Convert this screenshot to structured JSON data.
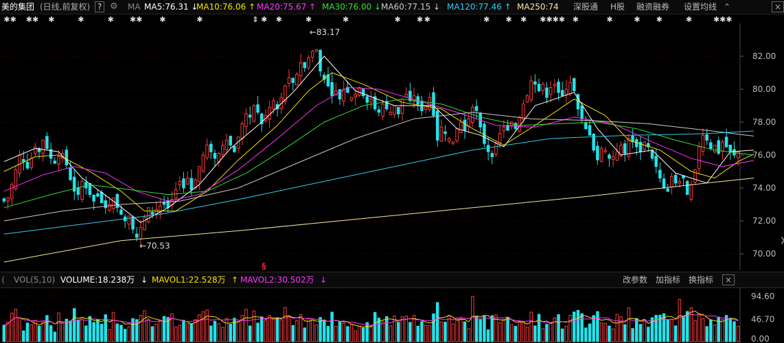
{
  "header": {
    "stock_name": "美的集团",
    "period_label": "(日线,前复权)",
    "help_label": "?",
    "ma_label": "MA",
    "ma_values": [
      {
        "label": "MA5:76.31",
        "arrow": "↓",
        "color": "#ffffff"
      },
      {
        "label": "MA10:76.06",
        "arrow": "↑",
        "color": "#f5e000"
      },
      {
        "label": "MA20:75.67",
        "arrow": "↑",
        "color": "#ff33ff"
      },
      {
        "label": "MA30:76.00",
        "arrow": "↓",
        "color": "#33dd33"
      },
      {
        "label": "MA60:77.15",
        "arrow": "↓",
        "color": "#cccccc"
      },
      {
        "label": "MA120:77.46",
        "arrow": "↑",
        "color": "#33ccee"
      },
      {
        "label": "MA250:74",
        "arrow": "",
        "color": "#f5e9a0"
      }
    ],
    "menu": [
      "深股通",
      "H股",
      "融资融券",
      "设置均线"
    ],
    "close_label": "×"
  },
  "markers": [
    {
      "label": "✱✱",
      "pos": 0.005
    },
    {
      "label": "✱✱",
      "pos": 0.035
    },
    {
      "label": "✱",
      "pos": 0.065
    },
    {
      "label": "✱",
      "pos": 0.105
    },
    {
      "label": "✱",
      "pos": 0.145
    },
    {
      "label": "✱✱",
      "pos": 0.175
    },
    {
      "label": "✱",
      "pos": 0.215
    },
    {
      "label": "✱",
      "pos": 0.265
    },
    {
      "label": "⇕",
      "pos": 0.34
    },
    {
      "label": "✱",
      "pos": 0.352
    },
    {
      "label": "✱",
      "pos": 0.372
    },
    {
      "label": "✱",
      "pos": 0.412
    },
    {
      "label": "✱",
      "pos": 0.462
    },
    {
      "label": "✱",
      "pos": 0.532
    },
    {
      "label": "✱",
      "pos": 0.562
    },
    {
      "label": "✱",
      "pos": 0.572
    },
    {
      "label": "✱",
      "pos": 0.652
    },
    {
      "label": "✱",
      "pos": 0.682
    },
    {
      "label": "✱",
      "pos": 0.702
    },
    {
      "label": "✱✱✱✱",
      "pos": 0.728
    },
    {
      "label": "✱",
      "pos": 0.772
    },
    {
      "label": "✱",
      "pos": 0.818
    },
    {
      "label": "✱",
      "pos": 0.855
    },
    {
      "label": "✱",
      "pos": 0.885
    },
    {
      "label": "✱",
      "pos": 0.925
    },
    {
      "label": "✱✱✱",
      "pos": 0.962
    }
  ],
  "chart_data": {
    "type": "candlestick",
    "ylim": [
      69,
      84
    ],
    "yticks": [
      70.0,
      72.0,
      74.0,
      76.0,
      78.0,
      80.0,
      82.0
    ],
    "annotations": {
      "high": {
        "label": "83.17",
        "index": 80
      },
      "low": {
        "label": "70.53",
        "index": 34
      }
    },
    "red_marker": {
      "label": "§",
      "index": 66,
      "color": "#ff2020"
    },
    "base_prices": [
      73.2,
      73.4,
      74.2,
      75.1,
      76.0,
      75.6,
      75.2,
      75.8,
      76.5,
      76.2,
      76.9,
      76.4,
      75.8,
      75.5,
      75.9,
      76.1,
      75.4,
      74.5,
      73.8,
      73.6,
      74.4,
      74.0,
      73.6,
      73.2,
      73.5,
      73.1,
      72.8,
      73.0,
      73.4,
      72.8,
      72.4,
      72.0,
      72.3,
      71.5,
      71.0,
      71.6,
      72.2,
      72.8,
      72.4,
      72.7,
      72.9,
      73.0,
      72.8,
      73.3,
      73.9,
      74.4,
      74.0,
      74.6,
      73.9,
      74.5,
      75.3,
      76.0,
      76.6,
      76.2,
      75.8,
      76.1,
      76.6,
      76.9,
      76.6,
      76.2,
      77.1,
      77.9,
      78.5,
      78.3,
      79.0,
      78.6,
      77.9,
      78.4,
      78.9,
      79.3,
      78.8,
      79.5,
      80.2,
      80.7,
      80.4,
      80.9,
      81.6,
      81.3,
      81.9,
      82.3,
      82.4,
      81.1,
      80.6,
      80.2,
      79.6,
      79.9,
      79.4,
      80.0,
      79.8,
      79.5,
      79.7,
      80.1,
      79.6,
      79.2,
      79.4,
      78.8,
      78.6,
      79.1,
      78.8,
      78.6,
      79.0,
      78.5,
      79.4,
      79.7,
      79.3,
      79.6,
      79.1,
      78.7,
      79.0,
      79.5,
      78.4,
      76.9,
      77.7,
      77.3,
      77.0,
      76.8,
      77.6,
      78.0,
      77.5,
      78.2,
      78.9,
      78.7,
      77.7,
      76.7,
      76.2,
      75.9,
      76.7,
      77.3,
      77.7,
      77.5,
      78.0,
      77.6,
      78.3,
      79.1,
      79.6,
      80.5,
      80.3,
      79.9,
      80.3,
      79.5,
      80.1,
      80.3,
      79.8,
      79.6,
      80.0,
      80.4,
      79.9,
      78.8,
      78.2,
      77.6,
      77.2,
      76.3,
      75.7,
      76.4,
      76.3,
      75.8,
      75.9,
      76.2,
      76.6,
      76.1,
      77.0,
      76.8,
      76.5,
      76.2,
      76.8,
      76.5,
      75.8,
      75.3,
      74.6,
      74.0,
      73.8,
      74.7,
      74.3,
      74.4,
      74.6,
      73.6,
      74.2,
      75.1,
      76.5,
      77.2,
      76.9,
      76.4,
      76.6,
      76.1,
      76.8,
      76.5,
      76.2,
      76.0,
      76.2
    ],
    "ma_series": [
      {
        "name": "MA5",
        "color": "#ffffff",
        "points": [
          [
            0,
            75.6
          ],
          [
            8,
            76.4
          ],
          [
            14,
            76.2
          ],
          [
            20,
            74.6
          ],
          [
            28,
            73.2
          ],
          [
            35,
            71.9
          ],
          [
            42,
            72.8
          ],
          [
            50,
            74.2
          ],
          [
            58,
            76.4
          ],
          [
            66,
            78.0
          ],
          [
            74,
            79.8
          ],
          [
            82,
            82.0
          ],
          [
            90,
            79.9
          ],
          [
            100,
            79.0
          ],
          [
            110,
            79.0
          ],
          [
            116,
            77.6
          ],
          [
            122,
            77.2
          ],
          [
            128,
            76.5
          ],
          [
            136,
            79.0
          ],
          [
            146,
            79.8
          ],
          [
            152,
            77.6
          ],
          [
            158,
            76.0
          ],
          [
            166,
            76.3
          ],
          [
            172,
            74.9
          ],
          [
            180,
            74.3
          ],
          [
            186,
            76.2
          ],
          [
            192,
            76.3
          ]
        ]
      },
      {
        "name": "MA10",
        "color": "#f5e000",
        "points": [
          [
            0,
            75.0
          ],
          [
            8,
            75.9
          ],
          [
            14,
            76.0
          ],
          [
            22,
            75.0
          ],
          [
            30,
            73.8
          ],
          [
            36,
            72.6
          ],
          [
            44,
            72.6
          ],
          [
            52,
            73.8
          ],
          [
            60,
            75.7
          ],
          [
            70,
            77.8
          ],
          [
            78,
            79.9
          ],
          [
            84,
            81.0
          ],
          [
            92,
            80.3
          ],
          [
            102,
            79.2
          ],
          [
            112,
            78.8
          ],
          [
            120,
            77.6
          ],
          [
            128,
            76.6
          ],
          [
            136,
            77.8
          ],
          [
            146,
            79.4
          ],
          [
            154,
            78.4
          ],
          [
            160,
            76.9
          ],
          [
            168,
            76.3
          ],
          [
            176,
            75.0
          ],
          [
            182,
            74.6
          ],
          [
            188,
            75.6
          ],
          [
            192,
            76.06
          ]
        ]
      },
      {
        "name": "MA20",
        "color": "#ff33ff",
        "points": [
          [
            0,
            73.8
          ],
          [
            10,
            74.8
          ],
          [
            18,
            75.3
          ],
          [
            26,
            74.9
          ],
          [
            34,
            73.8
          ],
          [
            42,
            73.2
          ],
          [
            50,
            73.6
          ],
          [
            60,
            75.1
          ],
          [
            70,
            77.0
          ],
          [
            80,
            79.0
          ],
          [
            88,
            80.1
          ],
          [
            96,
            80.0
          ],
          [
            106,
            79.3
          ],
          [
            116,
            78.6
          ],
          [
            126,
            77.8
          ],
          [
            136,
            77.7
          ],
          [
            146,
            78.3
          ],
          [
            156,
            77.9
          ],
          [
            166,
            76.8
          ],
          [
            176,
            75.8
          ],
          [
            184,
            75.3
          ],
          [
            192,
            75.67
          ]
        ]
      },
      {
        "name": "MA30",
        "color": "#33dd33",
        "points": [
          [
            0,
            72.8
          ],
          [
            12,
            73.6
          ],
          [
            22,
            74.2
          ],
          [
            32,
            73.9
          ],
          [
            42,
            73.6
          ],
          [
            52,
            73.8
          ],
          [
            62,
            74.9
          ],
          [
            72,
            76.4
          ],
          [
            82,
            78.0
          ],
          [
            92,
            79.0
          ],
          [
            102,
            79.4
          ],
          [
            112,
            79.1
          ],
          [
            122,
            78.3
          ],
          [
            132,
            77.8
          ],
          [
            142,
            77.9
          ],
          [
            152,
            78.0
          ],
          [
            162,
            77.6
          ],
          [
            172,
            76.9
          ],
          [
            182,
            76.3
          ],
          [
            192,
            76.0
          ]
        ]
      },
      {
        "name": "MA60",
        "color": "#cccccc",
        "points": [
          [
            0,
            72.0
          ],
          [
            15,
            72.6
          ],
          [
            30,
            73.0
          ],
          [
            45,
            73.2
          ],
          [
            60,
            74.0
          ],
          [
            75,
            75.5
          ],
          [
            90,
            77.0
          ],
          [
            105,
            78.2
          ],
          [
            120,
            78.6
          ],
          [
            135,
            78.2
          ],
          [
            150,
            78.1
          ],
          [
            165,
            77.9
          ],
          [
            180,
            77.5
          ],
          [
            192,
            77.15
          ]
        ]
      },
      {
        "name": "MA120",
        "color": "#33ccee",
        "points": [
          [
            0,
            71.2
          ],
          [
            20,
            71.8
          ],
          [
            40,
            72.4
          ],
          [
            60,
            73.3
          ],
          [
            80,
            74.3
          ],
          [
            100,
            75.3
          ],
          [
            120,
            76.3
          ],
          [
            140,
            77.0
          ],
          [
            160,
            77.2
          ],
          [
            180,
            77.3
          ],
          [
            192,
            77.46
          ]
        ]
      },
      {
        "name": "MA250",
        "color": "#f5e9a0",
        "points": [
          [
            0,
            69.5
          ],
          [
            30,
            70.8
          ],
          [
            60,
            71.4
          ],
          [
            90,
            72.1
          ],
          [
            120,
            72.8
          ],
          [
            150,
            73.5
          ],
          [
            180,
            74.3
          ],
          [
            192,
            74.6
          ]
        ]
      }
    ]
  },
  "volume_header": {
    "indicator_label": "VOL(5,10)",
    "volume_label": "VOLUME:18.238万",
    "volume_arrow": "↓",
    "mavol1_label": "MAVOL1:22.528万",
    "mavol1_arrow": "↑",
    "mavol2_label": "MAVOL2:30.502万",
    "mavol2_arrow": "↓",
    "buttons": [
      "改参数",
      "加指标",
      "换指标"
    ],
    "close_label": "×"
  },
  "volume_chart": {
    "yticks": [
      "94.60",
      "46.70",
      "0.00"
    ],
    "ylim": [
      0,
      110
    ],
    "mavol1_color": "#f5e000",
    "mavol2_color": "#ff33ff"
  },
  "colors": {
    "up": "#ff3b3b",
    "down": "#26e0e8",
    "grid": "#3a0000"
  }
}
